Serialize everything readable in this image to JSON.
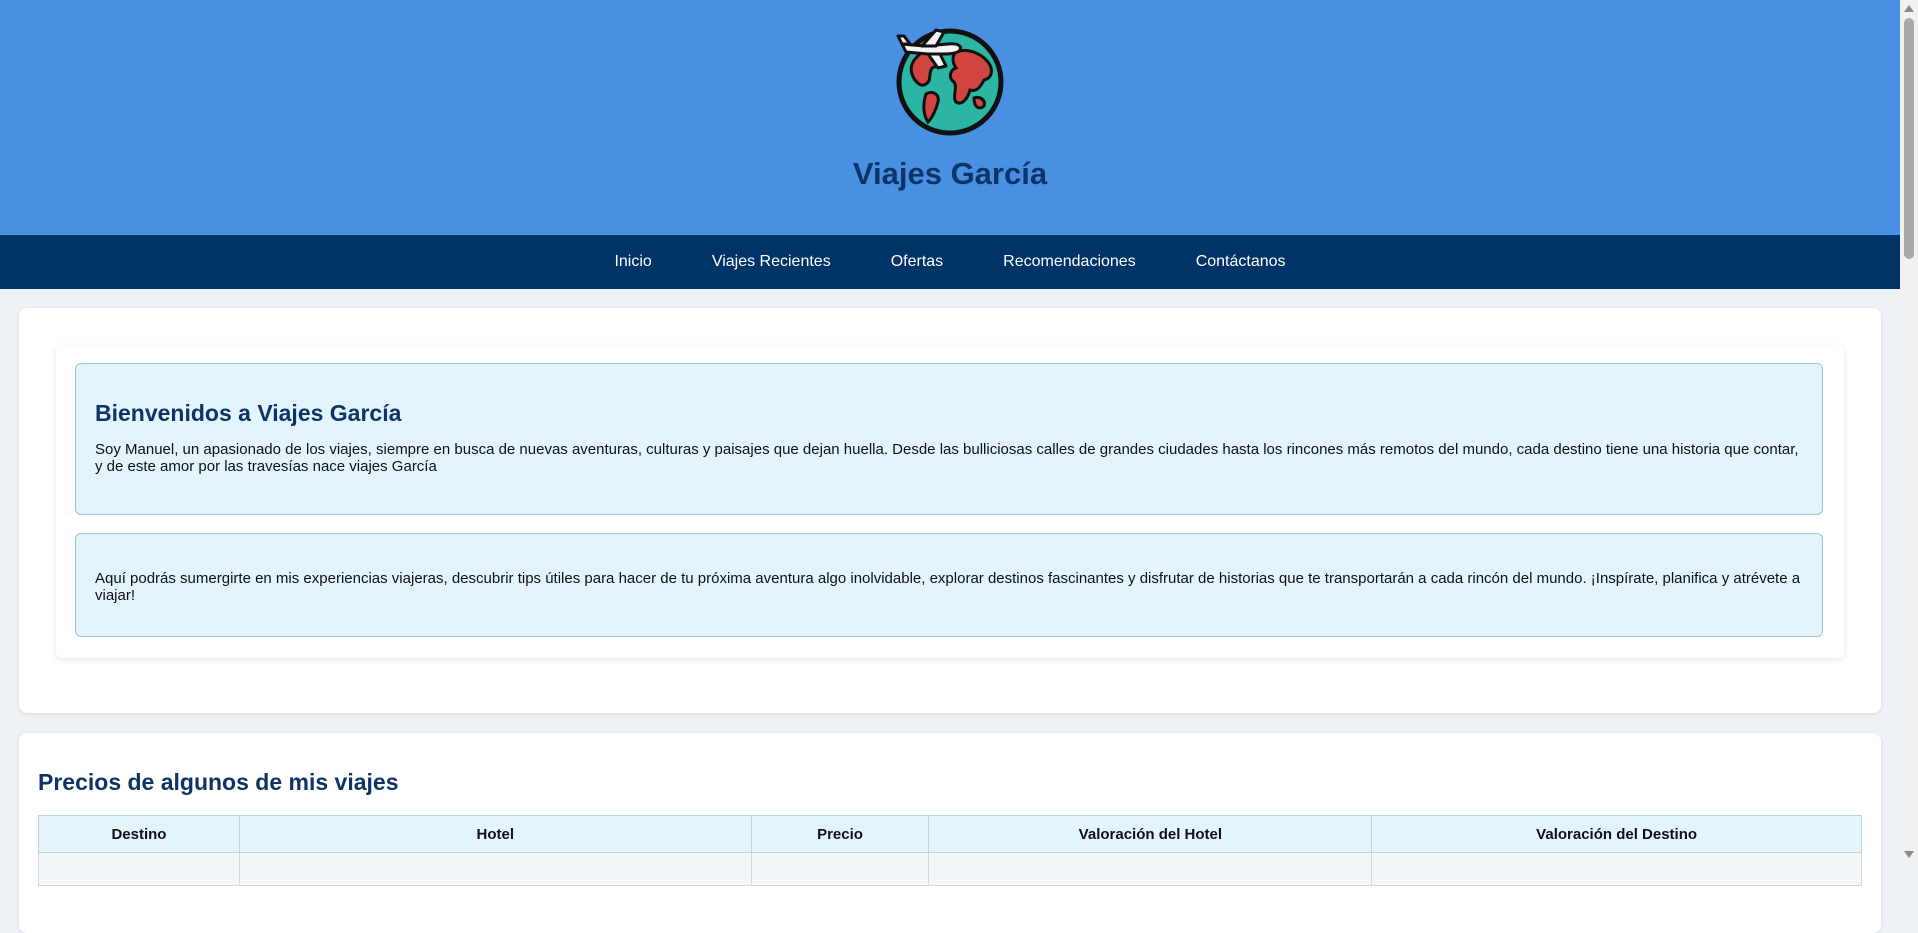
{
  "header": {
    "title": "Viajes García",
    "logo_icon": "globe-airplane-icon"
  },
  "nav": {
    "items": [
      {
        "label": "Inicio"
      },
      {
        "label": "Viajes Recientes"
      },
      {
        "label": "Ofertas"
      },
      {
        "label": "Recomendaciones"
      },
      {
        "label": "Contáctanos"
      }
    ]
  },
  "welcome": {
    "heading": "Bienvenidos a Viajes García",
    "paragraph1": "Soy Manuel, un apasionado de los viajes, siempre en busca de nuevas aventuras, culturas y paisajes que dejan huella. Desde las bulliciosas calles de grandes ciudades hasta los rincones más remotos del mundo, cada destino tiene una historia que contar, y de este amor por las travesías nace viajes García",
    "paragraph2": "Aquí podrás sumergirte en mis experiencias viajeras, descubrir tips útiles para hacer de tu próxima aventura algo inolvidable, explorar destinos fascinantes y disfrutar de historias que te transportarán a cada rincón del mundo. ¡Inspírate, planifica y atrévete a viajar!"
  },
  "prices": {
    "heading": "Precios de algunos de mis viajes",
    "columns": [
      "Destino",
      "Hotel",
      "Precio",
      "Valoración del Hotel",
      "Valoración del Destino"
    ]
  },
  "colors": {
    "header_bg": "#4a90e2",
    "nav_bg": "#003366",
    "title": "#0d3466",
    "info_box_bg": "#e3f4fd"
  }
}
